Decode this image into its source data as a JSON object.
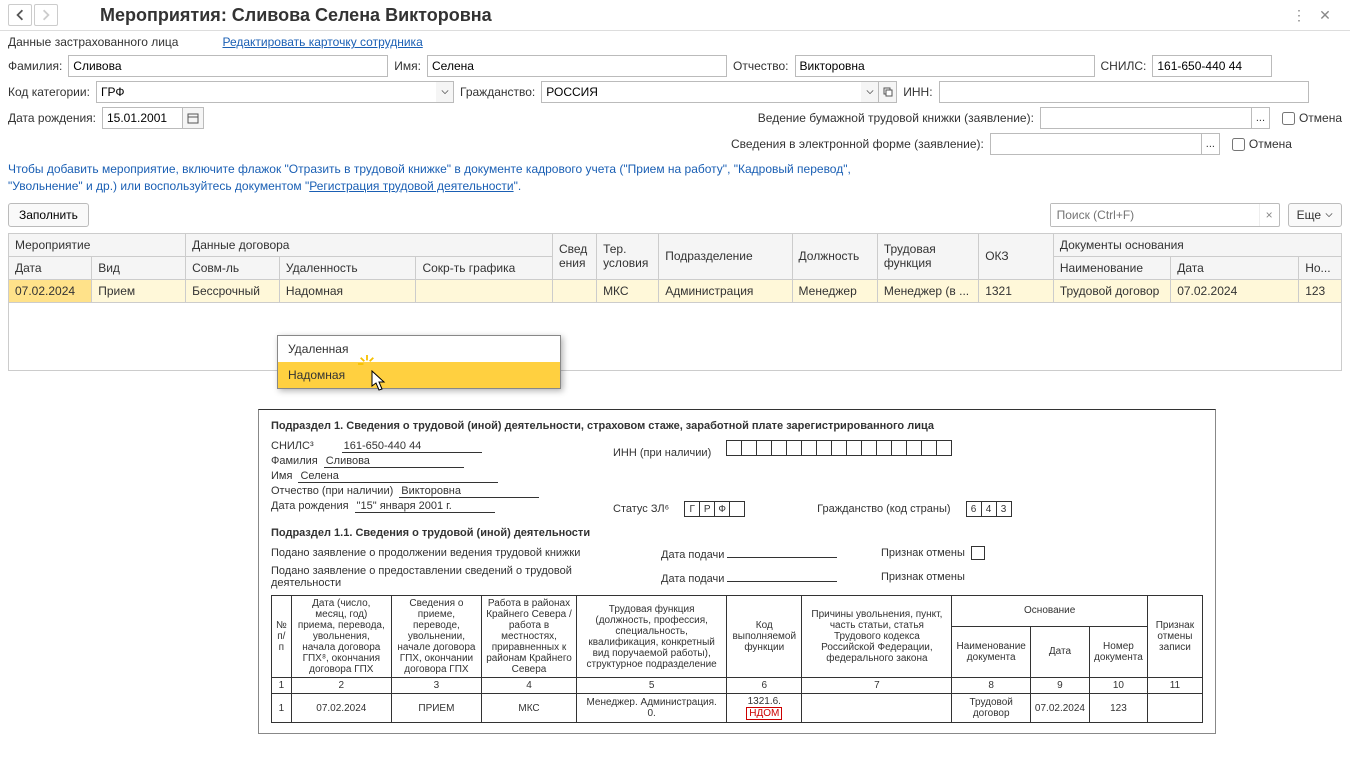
{
  "header": {
    "title": "Мероприятия: Сливова Селена Викторовна"
  },
  "insured": {
    "section_label": "Данные застрахованного лица",
    "edit_link": "Редактировать карточку сотрудника",
    "lastname_label": "Фамилия:",
    "lastname": "Сливова",
    "firstname_label": "Имя:",
    "firstname": "Селена",
    "middlename_label": "Отчество:",
    "middlename": "Викторовна",
    "snils_label": "СНИЛС:",
    "snils": "161-650-440 44",
    "category_label": "Код категории:",
    "category": "ГРФ",
    "citizenship_label": "Гражданство:",
    "citizenship": "РОССИЯ",
    "inn_label": "ИНН:",
    "inn": "",
    "birthdate_label": "Дата рождения:",
    "birthdate": "15.01.2001",
    "paper_book_label": "Ведение бумажной трудовой книжки (заявление):",
    "paper_book": "",
    "electronic_label": "Сведения в электронной форме (заявление):",
    "electronic": "",
    "cancel": "Отмена"
  },
  "info_text": {
    "line1": "Чтобы добавить мероприятие, включите флажок \"Отразить в трудовой книжке\" в документе кадрового учета (\"Прием на работу\", \"Кадровый перевод\",",
    "line2a": "\"Увольнение\" и др.) или воспользуйтесь документом \"",
    "link": "Регистрация трудовой деятельности",
    "line2b": "\"."
  },
  "actions": {
    "fill": "Заполнить",
    "search_placeholder": "Поиск (Ctrl+F)",
    "more": "Еще"
  },
  "table": {
    "h_event": "Мероприятие",
    "h_contract": "Данные договора",
    "h_sved": "Свед\nения",
    "h_ter": "Тер. условия",
    "h_dept": "Подразделение",
    "h_position": "Должность",
    "h_function": "Трудовая функция",
    "h_okz": "ОКЗ",
    "h_docs": "Документы основания",
    "h_date": "Дата",
    "h_type": "Вид",
    "h_combined": "Совм-ль",
    "h_remote": "Удаленность",
    "h_short": "Сокр-ть графика",
    "h_docname": "Наименование",
    "h_docdate": "Дата",
    "h_docnum": "Но...",
    "row": {
      "date": "07.02.2024",
      "type": "Прием",
      "combined": "Бессрочный",
      "remote": "Надомная",
      "short": "",
      "sved": "",
      "ter": "МКС",
      "dept": "Администрация",
      "position": "Менеджер",
      "function": "Менеджер (в ...",
      "okz": "1321",
      "docname": "Трудовой договор",
      "docdate": "07.02.2024",
      "docnum": "123"
    }
  },
  "dropdown": {
    "opt1": "Удаленная",
    "opt2": "Надомная"
  },
  "print": {
    "heading1": "Подраздел 1. Сведения о трудовой (иной) деятельности, страховом стаже, заработной плате зарегистрированного лица",
    "snils_label": "СНИЛС³",
    "snils": "161-650-440 44",
    "lastname_label": "Фамилия",
    "lastname": "Сливова",
    "firstname_label": "Имя",
    "firstname": "Селена",
    "middlename_label": "Отчество (при наличии)",
    "middlename": "Викторовна",
    "birthdate_label": "Дата рождения",
    "birthdate": "\"15\" января 2001 г.",
    "inn_label": "ИНН (при наличии)",
    "status_label": "Статус ЗЛ⁶",
    "status_g": "Г",
    "status_r": "Р",
    "status_f": "Ф",
    "citizenship_label": "Гражданство (код страны)",
    "citizenship_code": [
      "6",
      "4",
      "3"
    ],
    "heading11": "Подраздел 1.1. Сведения о трудовой (иной) деятельности",
    "decl_paper": "Подано заявление о продолжении ведения трудовой книжки",
    "decl_elec": "Подано заявление о предоставлении сведений о трудовой деятельности",
    "date_submit": "Дата подачи",
    "cancel_flag": "Признак отмены",
    "ptab": {
      "col1": "№ п/п",
      "col2": "Дата (число, месяц, год) приема, перевода, увольнения, начала договора ГПХ⁸, окончания договора ГПХ",
      "col3": "Сведения о приеме, переводе, увольнении, начале договора ГПХ, окончании договора ГПХ",
      "col4": "Работа в районах Крайнего Севера / работа в местностях, приравненных к районам Крайнего Севера",
      "col5": "Трудовая функция (должность, профессия, специальность, квалификация, конкретный вид поручаемой работы), структурное подразделение",
      "col6": "Код выполняемой функции",
      "col7": "Причины увольнения, пункт, часть статьи, статья Трудового кодекса Российской Федерации, федерального закона",
      "col8_group": "Основание",
      "col8": "Наименование документа",
      "col9": "Дата",
      "col10": "Номер документа",
      "col11": "Признак отмены записи",
      "n1": "1",
      "n2": "2",
      "n3": "3",
      "n4": "4",
      "n5": "5",
      "n6": "6",
      "n7": "7",
      "n8": "8",
      "n9": "9",
      "n10": "10",
      "n11": "11",
      "r_num": "1",
      "r_date": "07.02.2024",
      "r_action": "ПРИЕМ",
      "r_north": "МКС",
      "r_func": "Менеджер. Администрация. 0.",
      "r_code_a": "1321.6.",
      "r_code_b": "НДОМ",
      "r_reason": "",
      "r_docname": "Трудовой договор",
      "r_docdate": "07.02.2024",
      "r_docnum": "123",
      "r_cancel": ""
    }
  }
}
